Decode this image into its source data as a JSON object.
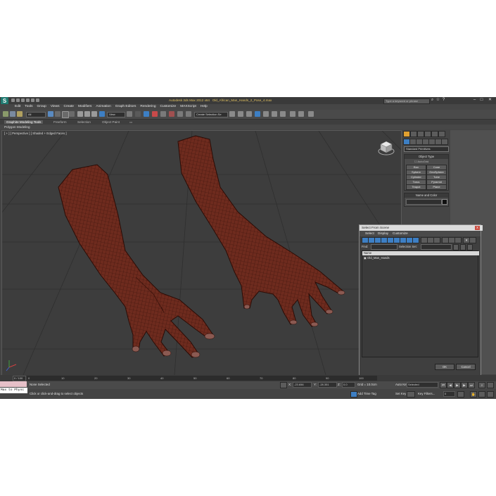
{
  "window": {
    "title_app": "Autodesk 3ds Max 2012 x64",
    "title_file": "Old_African_Man_Hands_2_Pose_4.max",
    "search_placeholder": "Type a keyword or phrase",
    "logo_glyph": "S"
  },
  "menu": [
    "Edit",
    "Tools",
    "Group",
    "Views",
    "Create",
    "Modifiers",
    "Animation",
    "Graph Editors",
    "Rendering",
    "Customize",
    "MAXScript",
    "Help"
  ],
  "toolbar": {
    "filter_dropdown": "All",
    "view_dropdown": "View",
    "selection_set_dropdown": "Create Selection Se"
  },
  "ribbon": {
    "tabs": [
      "Graphite Modeling Tools",
      "Freeform",
      "Selection",
      "Object Paint"
    ],
    "sub_label": "Polygon Modeling"
  },
  "viewport": {
    "label": "[ + ] [ Perspective ] [ Shaded + Edged Faces ]"
  },
  "command_panel": {
    "category_dropdown": "Standard Primitives",
    "object_type_header": "Object Type",
    "autogrid_label": "AutoGrid",
    "buttons": [
      "Box",
      "Cone",
      "Sphere",
      "GeoSphere",
      "Cylinder",
      "Tube",
      "Torus",
      "Pyramid",
      "Teapot",
      "Plane"
    ],
    "name_color_header": "Name and Color"
  },
  "dialog": {
    "title": "Select From Scene",
    "close_glyph": "x",
    "menu": [
      "Select",
      "Display",
      "Customize"
    ],
    "find_label": "Find:",
    "selection_set_label": "Selection Set:",
    "column_name": "Name",
    "items": [
      "Old_Man_Hands"
    ],
    "ok_label": "OK",
    "cancel_label": "Cancel"
  },
  "timeline": {
    "frame_counter": "0 / 100",
    "ticks": [
      "0",
      "10",
      "20",
      "30",
      "40",
      "50",
      "60",
      "70",
      "80",
      "90",
      "100"
    ]
  },
  "status": {
    "maxscript_text": "Max to Physc",
    "selection_text": "None Selected",
    "prompt_text": "Click or click-and-drag to select objects",
    "x_label": "X:",
    "x_value": "-23.656",
    "y_label": "Y:",
    "y_value": "-28.351",
    "z_label": "Z:",
    "z_value": "0.0",
    "grid_text": "Grid = 10.0cm",
    "add_time_tag": "Add Time Tag",
    "auto_key_label": "Auto Key",
    "auto_key_value": "Selected",
    "set_key_label": "Set Key",
    "key_filters_label": "Key Filters...",
    "frame_value": "0"
  },
  "colors": {
    "viewport_bg": "#3d3d3d",
    "grid_line": "#2f2f2f",
    "hand_skin": "#6e2b1e",
    "hand_wire": "#3a120b",
    "accent_blue": "#3d7fc4"
  }
}
